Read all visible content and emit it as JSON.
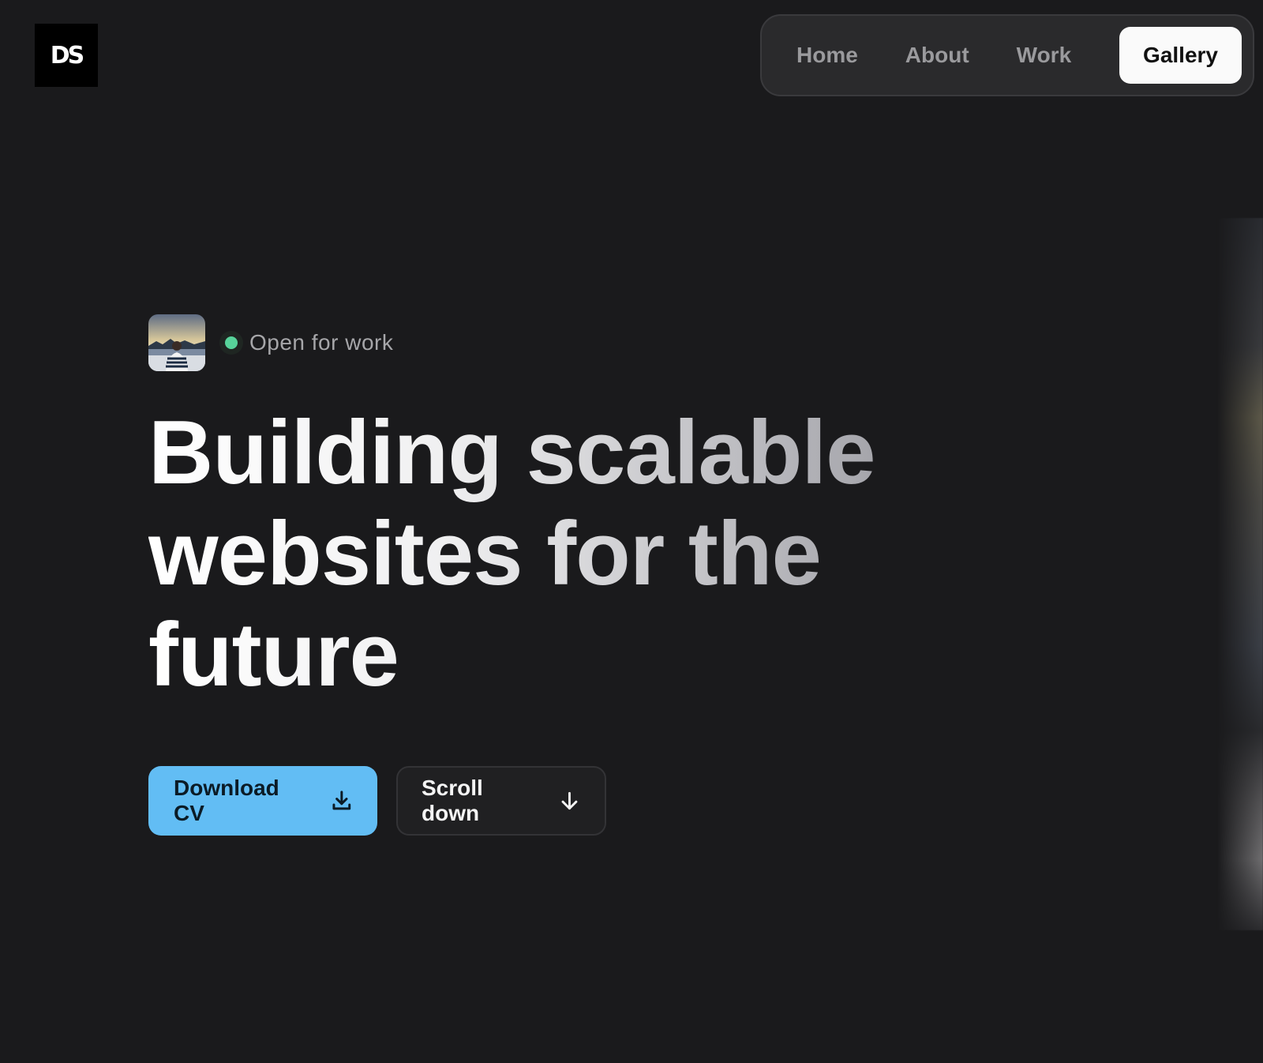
{
  "logo": {
    "text": "DS"
  },
  "nav": {
    "items": [
      {
        "label": "Home"
      },
      {
        "label": "About"
      },
      {
        "label": "Work"
      },
      {
        "label": "Gallery",
        "active": true
      }
    ]
  },
  "hero": {
    "status_text": "Open for work",
    "headline": "Building scalable websites for the future",
    "buttons": {
      "primary_label": "Download CV",
      "secondary_label": "Scroll down"
    }
  },
  "icons": {
    "avatar": "avatar-photo",
    "status_dot": "status-dot-icon",
    "download": "download-icon",
    "arrow_down": "arrow-down-icon"
  },
  "colors": {
    "background": "#1a1a1c",
    "accent": "#62bdf4",
    "status_green": "#57d39a",
    "nav_active_bg": "#fafafa"
  }
}
